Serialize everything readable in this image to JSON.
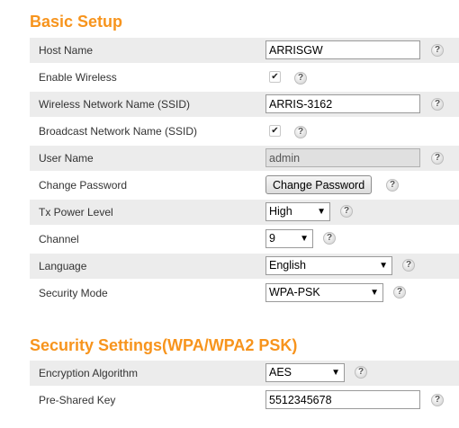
{
  "basic_setup": {
    "title": "Basic Setup",
    "host_name": {
      "label": "Host Name",
      "value": "ARRISGW"
    },
    "enable_wireless": {
      "label": "Enable Wireless",
      "checked": true,
      "mark": "✔"
    },
    "ssid": {
      "label": "Wireless Network Name (SSID)",
      "value": "ARRIS-3162"
    },
    "broadcast_ssid": {
      "label": "Broadcast Network Name (SSID)",
      "checked": true,
      "mark": "✔"
    },
    "user_name": {
      "label": "User Name",
      "value": "admin"
    },
    "change_password": {
      "label": "Change Password",
      "button": "Change Password"
    },
    "tx_power": {
      "label": "Tx Power Level",
      "selected": "High"
    },
    "channel": {
      "label": "Channel",
      "selected": "9"
    },
    "language": {
      "label": "Language",
      "selected": "English"
    },
    "security_mode": {
      "label": "Security Mode",
      "selected": "WPA-PSK"
    }
  },
  "security_settings": {
    "title": "Security Settings(WPA/WPA2 PSK)",
    "encryption": {
      "label": "Encryption Algorithm",
      "selected": "AES"
    },
    "psk": {
      "label": "Pre-Shared Key",
      "value": "5512345678"
    }
  },
  "icons": {
    "help": "?",
    "dropdown": "▼"
  },
  "colors": {
    "section_title": "#f7941d",
    "row_shade": "#ececec"
  }
}
